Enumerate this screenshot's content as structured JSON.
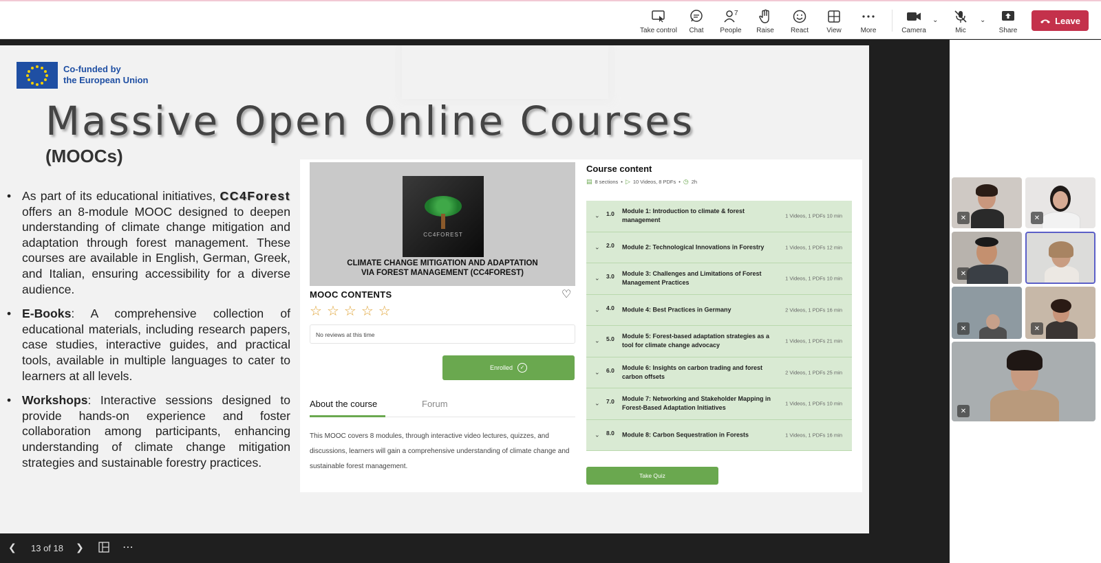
{
  "toolbar": {
    "items": [
      {
        "label": "Take control",
        "icon": "take-control-icon"
      },
      {
        "label": "Chat",
        "icon": "chat-icon"
      },
      {
        "label": "People",
        "icon": "people-icon",
        "count": "7"
      },
      {
        "label": "Raise",
        "icon": "raise-hand-icon"
      },
      {
        "label": "React",
        "icon": "react-icon"
      },
      {
        "label": "View",
        "icon": "view-icon"
      },
      {
        "label": "More",
        "icon": "more-icon"
      },
      {
        "label": "Camera",
        "icon": "camera-icon"
      },
      {
        "label": "Mic",
        "icon": "mic-off-icon"
      },
      {
        "label": "Share",
        "icon": "share-icon"
      }
    ],
    "leave_label": "Leave",
    "leave_color": "#c4314b"
  },
  "slide": {
    "eu_text_line1": "Co-funded by",
    "eu_text_line2": "the European Union",
    "title": "Massive Open Online Courses",
    "subtitle": "(MOOCs)",
    "bullets": {
      "b1_pre": "As part of its educational initiatives, ",
      "b1_brand": "CC4Forest",
      "b1_post": " offers an 8-module MOOC designed to deepen understanding of climate change mitigation and adaptation through forest management. These courses are available in English, German, Greek, and Italian, ensuring accessibility for a diverse audience.",
      "b2_bold": "E-Books",
      "b2_text": ": A comprehensive collection of educational materials, including research papers, case studies, interactive guides, and practical tools, available in multiple languages to cater to learners at all levels.",
      "b3_bold": "Workshops",
      "b3_text": ": Interactive sessions designed to provide hands-on experience and foster collaboration among participants, enhancing understanding of climate change mitigation strategies and sustainable forestry practices."
    },
    "course": {
      "cover_brand": "CC4FOREST",
      "hero_title_line1": "CLIMATE CHANGE MITIGATION AND ADAPTATION",
      "hero_title_line2": "VIA FOREST MANAGEMENT (CC4FOREST)",
      "mooc_heading": "MOOC CONTENTS",
      "reviews_text": "No reviews at this time",
      "enrolled_label": "Enrolled",
      "tab_about": "About the course",
      "tab_forum": "Forum",
      "about_text": "This MOOC covers 8 modules, through interactive video lectures, quizzes, and discussions, learners will gain a comprehensive understanding of climate change and sustainable forest management.",
      "content_heading": "Course content",
      "meta_sections": "8 sections",
      "meta_media": "10 Videos, 8 PDFs",
      "meta_time": "2h",
      "modules": [
        {
          "num": "1.0",
          "title": "Module 1: Introduction to climate & forest management",
          "meta": "1 Videos, 1 PDFs   10 min"
        },
        {
          "num": "2.0",
          "title": "Module 2: Technological Innovations in Forestry",
          "meta": "1 Videos, 1 PDFs   12 min"
        },
        {
          "num": "3.0",
          "title": "Module 3: Challenges and Limitations of Forest Management Practices",
          "meta": "1 Videos, 1 PDFs   10 min"
        },
        {
          "num": "4.0",
          "title": "Module 4: Best Practices in Germany",
          "meta": "2 Videos, 1 PDFs   16 min"
        },
        {
          "num": "5.0",
          "title": "Module 5: Forest-based adaptation strategies as a tool for climate change advocacy",
          "meta": "1 Videos, 1 PDFs   21 min"
        },
        {
          "num": "6.0",
          "title": "Module 6: Insights on carbon trading and forest carbon offsets",
          "meta": "2 Videos, 1 PDFs   25 min"
        },
        {
          "num": "7.0",
          "title": "Module 7: Networking and Stakeholder Mapping in Forest-Based Adaptation Initiatives",
          "meta": "1 Videos, 1 PDFs   10 min"
        },
        {
          "num": "8.0",
          "title": "Module 8: Carbon Sequestration in Forests",
          "meta": "1 Videos, 1 PDFs   16 min"
        }
      ],
      "quiz_label": "Take Quiz",
      "accent": "#6aa84f"
    }
  },
  "bottom": {
    "page_count": "13 of 18"
  }
}
